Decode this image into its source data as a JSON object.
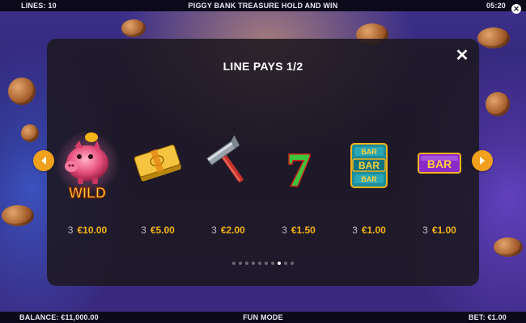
{
  "topbar": {
    "lines": "LINES: 10",
    "title": "PIGGY BANK TREASURE HOLD AND WIN",
    "time": "05:20",
    "close_icon": "close-icon"
  },
  "panel": {
    "title": "LINE PAYS 1/2",
    "close_icon": "close-icon",
    "prev_icon": "chevron-left-icon",
    "next_icon": "chevron-right-icon",
    "page_indicator": {
      "total": 10,
      "active_index": 7
    }
  },
  "symbols": [
    {
      "name": "piggy-wild",
      "label": "WILD",
      "count": "3",
      "amount": "€10.00"
    },
    {
      "name": "money-bundle",
      "count": "3",
      "amount": "€5.00"
    },
    {
      "name": "hammer",
      "count": "3",
      "amount": "€2.00"
    },
    {
      "name": "seven",
      "label": "7",
      "count": "3",
      "amount": "€1.50"
    },
    {
      "name": "triple-bar",
      "label": "BAR",
      "count": "3",
      "amount": "€1.00"
    },
    {
      "name": "bar",
      "label": "BAR",
      "count": "3",
      "amount": "€1.00"
    }
  ],
  "bottombar": {
    "balance": "BALANCE: €11,000.00",
    "mode": "FUN MODE",
    "bet": "BET: €1.00"
  },
  "colors": {
    "accent": "#f0a01c",
    "amount": "#f2b316",
    "panel": "#1c1820"
  }
}
